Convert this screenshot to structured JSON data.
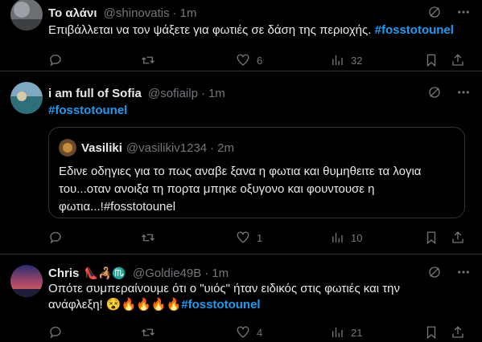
{
  "tweets": [
    {
      "name": "Το αλάνι",
      "handle": "@shinovatis",
      "time": "1m",
      "text": "Επιβάλλεται να τον ψάξετε για φωτιές σε δάση της περιοχής.",
      "hashtag": "#fosstotounel",
      "replies": "",
      "retweets": "",
      "likes": "6",
      "views": "32"
    },
    {
      "name": "i am full of Sofia",
      "handle": "@sofiailp",
      "time": "1m",
      "hashtag": "#fosstotounel",
      "replies": "",
      "retweets": "",
      "likes": "1",
      "views": "10",
      "quote": {
        "name": "Vasiliki",
        "handle": "@vasilikiv1234",
        "time": "2m",
        "line1": "Εδινε οδηγιες για το πως αναβε ξανα η φωτια και θυμηθειτε τα λογια",
        "line2": "του...οταν ανοιξα τη πορτα μπηκε οξυγονο και φουντουσε η",
        "line3": "φωτια...!#fosstotounel"
      }
    },
    {
      "name": "Chris",
      "name_emojis": "👠🦂♏",
      "handle": "@Goldie49B",
      "time": "1m",
      "line1": "Οπότε συμπεραίνουμε ότι ο \"υιός\" ήταν ειδικός στις φωτιές και την",
      "line2": "ανάφλεξη! 😵🔥🔥🔥🔥",
      "hashtag": "#fosstotounel",
      "replies": "",
      "retweets": "",
      "likes": "4",
      "views": "21"
    }
  ],
  "colors": {
    "background": "#000000",
    "text": "#e7e9ea",
    "secondary": "#71767b",
    "accent": "#1d9bf0",
    "border": "#2f3336"
  }
}
